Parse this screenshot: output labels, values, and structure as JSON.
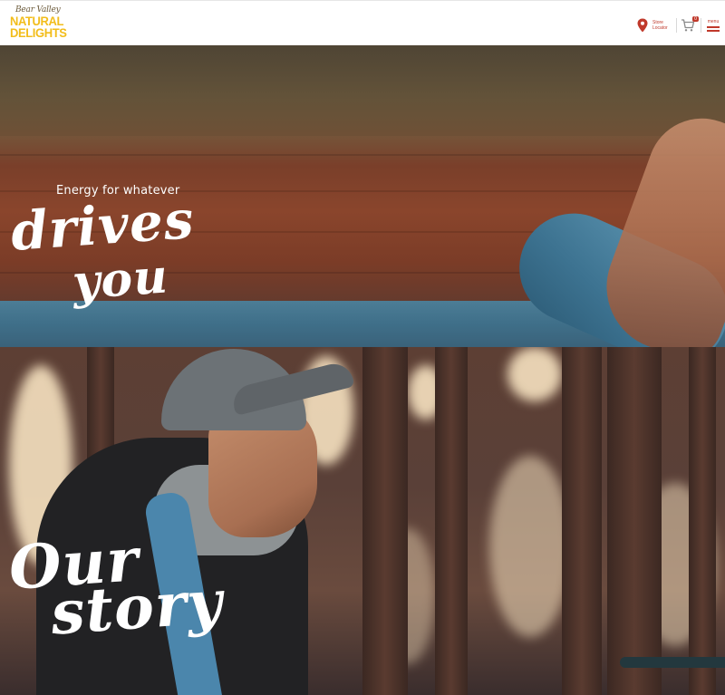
{
  "header": {
    "logo": {
      "script": "Bear Valley",
      "line1": "NATURAL",
      "line2": "DELIGHTS"
    },
    "store_locator": "Store Locator",
    "cart_count": "0",
    "menu_label": "menu",
    "icons": [
      "map-pin-icon",
      "cart-icon",
      "hamburger-menu-icon"
    ],
    "colors": {
      "brand_yellow": "#f2bd1b",
      "accent_red": "#c0392b"
    }
  },
  "hero_drives": {
    "tagline": "Energy for whatever",
    "script_line1": "drives",
    "script_line2": "you"
  },
  "hero_story": {
    "script_line1": "Our",
    "script_line2": "story"
  }
}
